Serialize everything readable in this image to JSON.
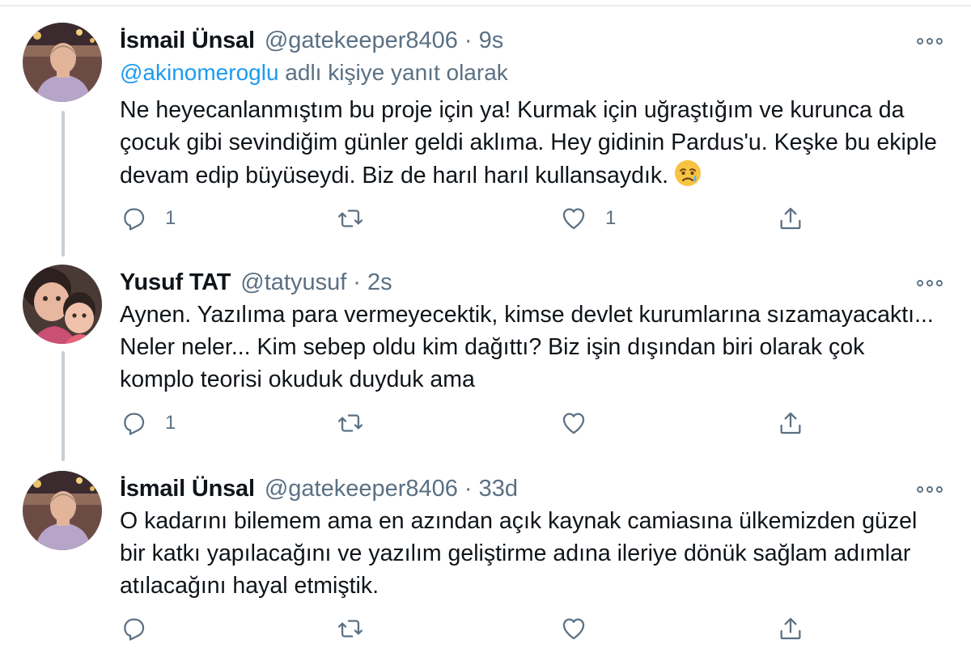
{
  "tweets": [
    {
      "author_name": "İsmail Ünsal",
      "handle": "@gatekeeper8406",
      "separator": "·",
      "time": "9s",
      "reply_to_mention": "@akinomeroglu",
      "reply_to_suffix": " adlı kişiye yanıt olarak",
      "text": "Ne heyecanlanmıştım bu proje için ya! Kurmak için uğraştığım ve kurunca da çocuk gibi sevindiğim günler geldi aklıma. Hey gidinin Pardus'u. Keşke bu ekiple devam edip büyüseydi. Biz de harıl harıl kullansaydık.",
      "emoji": "sad-but-relieved-face-emoji",
      "reply_count": "1",
      "retweet_count": "",
      "like_count": "1",
      "avatar": "person-photo-avatar"
    },
    {
      "author_name": "Yusuf TAT",
      "handle": "@tatyusuf",
      "separator": "·",
      "time": "2s",
      "text": "Aynen. Yazılıma para vermeyecektik, kimse devlet kurumlarına sızamayacaktı... Neler neler... Kim sebep oldu kim dağıttı? Biz işin dışından biri olarak çok komplo teorisi okuduk duyduk ama",
      "reply_count": "1",
      "retweet_count": "",
      "like_count": "",
      "avatar": "children-photo-avatar"
    },
    {
      "author_name": "İsmail Ünsal",
      "handle": "@gatekeeper8406",
      "separator": "·",
      "time": "33d",
      "text": "O kadarını bilemem ama en azından açık kaynak camiasına ülkemizden güzel bir katkı yapılacağını ve yazılım geliştirme adına ileriye dönük sağlam adımlar atılacağını hayal etmiştik.",
      "reply_count": "",
      "retweet_count": "",
      "like_count": "",
      "avatar": "person-photo-avatar"
    }
  ],
  "icons": {
    "reply": "reply-icon",
    "retweet": "retweet-icon",
    "like": "like-icon",
    "share": "share-icon",
    "more": "more-icon"
  },
  "colors": {
    "text": "#0f1419",
    "secondary": "#5b7083",
    "link": "#1d9bf0",
    "thread_line": "#c4cfd6"
  }
}
